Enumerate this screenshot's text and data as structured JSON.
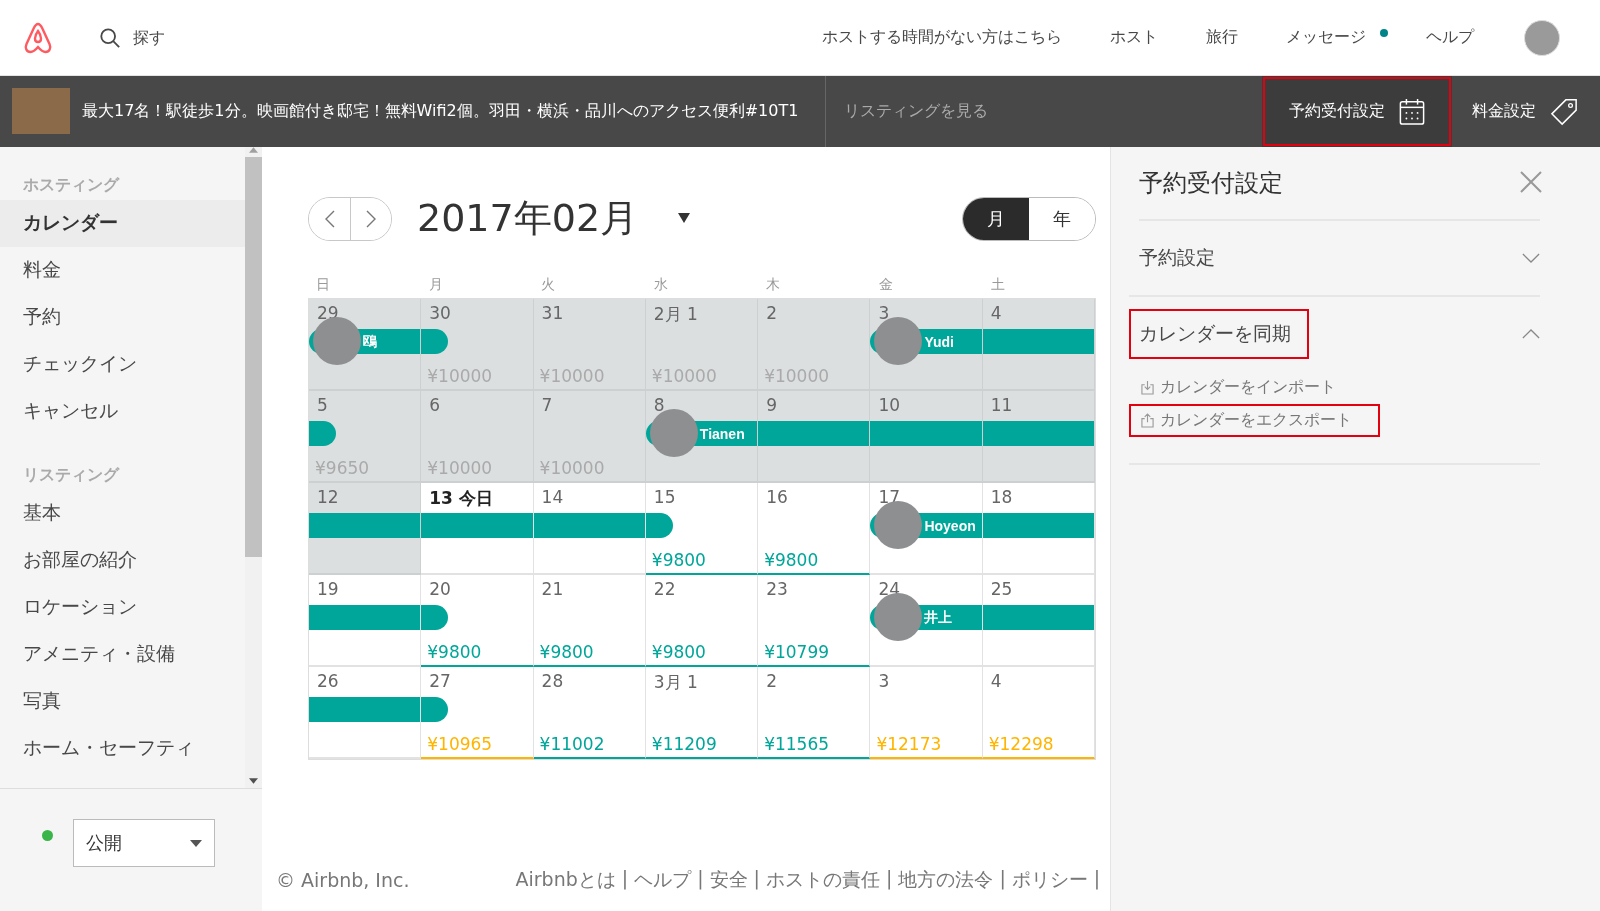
{
  "top_nav": {
    "search": {
      "placeholder": "探す"
    },
    "links": [
      {
        "label": "ホストする時間がない方はこちら",
        "unread": false
      },
      {
        "label": "ホスト",
        "unread": false
      },
      {
        "label": "旅行",
        "unread": false
      },
      {
        "label": "メッセージ",
        "unread": true
      },
      {
        "label": "ヘルプ",
        "unread": false
      }
    ]
  },
  "listing_bar": {
    "title": "最大17名！駅徒歩1分。映画館付き邸宅！無料Wifi2個。羽田・横浜・品川へのアクセス便利#10T1",
    "view_link": "リスティングを見る",
    "buttons": [
      {
        "label": "予約受付設定",
        "kind": "calendar",
        "selected": true,
        "highlighted": true
      },
      {
        "label": "料金設定",
        "kind": "tag",
        "selected": false,
        "highlighted": false
      }
    ]
  },
  "sidebar": {
    "sections": [
      {
        "heading": "ホスティング",
        "items": [
          {
            "label": "カレンダー",
            "selected": true
          },
          {
            "label": "料金",
            "selected": false
          },
          {
            "label": "予約",
            "selected": false
          },
          {
            "label": "チェックイン",
            "selected": false
          },
          {
            "label": "キャンセル",
            "selected": false
          }
        ]
      },
      {
        "heading": "リスティング",
        "items": [
          {
            "label": "基本",
            "selected": false
          },
          {
            "label": "お部屋の紹介",
            "selected": false
          },
          {
            "label": "ロケーション",
            "selected": false
          },
          {
            "label": "アメニティ・設備",
            "selected": false
          },
          {
            "label": "写真",
            "selected": false
          },
          {
            "label": "ホーム・セーフティ",
            "selected": false
          }
        ]
      }
    ],
    "status": {
      "value": "公開"
    }
  },
  "calendar": {
    "month": "2017年02月",
    "views": [
      {
        "label": "月",
        "selected": true
      },
      {
        "label": "年",
        "selected": false
      }
    ],
    "weekdays": [
      "日",
      "月",
      "火",
      "水",
      "木",
      "金",
      "土"
    ],
    "weeks": [
      [
        {
          "date": "29",
          "past": true,
          "today": false,
          "booked": true,
          "checkout": false,
          "guest": "鴎"
        },
        {
          "date": "30",
          "price": "¥10000",
          "high_demand": false,
          "past": true,
          "today": false,
          "booked": false,
          "checkout": true
        },
        {
          "date": "31",
          "price": "¥10000",
          "high_demand": false,
          "past": true,
          "today": false,
          "booked": false,
          "checkout": false
        },
        {
          "date": "2月 1",
          "price": "¥10000",
          "high_demand": false,
          "past": true,
          "today": false,
          "booked": false,
          "checkout": false
        },
        {
          "date": "2",
          "price": "¥10000",
          "high_demand": false,
          "past": true,
          "today": false,
          "booked": false,
          "checkout": false
        },
        {
          "date": "3",
          "past": true,
          "today": false,
          "booked": true,
          "checkout": false,
          "guest": "Yudi"
        },
        {
          "date": "4",
          "past": true,
          "today": false,
          "booked": true,
          "checkout": false
        }
      ],
      [
        {
          "date": "5",
          "price": "¥9650",
          "high_demand": false,
          "past": true,
          "today": false,
          "booked": false,
          "checkout": true
        },
        {
          "date": "6",
          "price": "¥10000",
          "high_demand": false,
          "past": true,
          "today": false,
          "booked": false,
          "checkout": false
        },
        {
          "date": "7",
          "price": "¥10000",
          "high_demand": false,
          "past": true,
          "today": false,
          "booked": false,
          "checkout": false
        },
        {
          "date": "8",
          "past": true,
          "today": false,
          "booked": true,
          "checkout": false,
          "guest": "Tianen"
        },
        {
          "date": "9",
          "past": true,
          "today": false,
          "booked": true,
          "checkout": false
        },
        {
          "date": "10",
          "past": true,
          "today": false,
          "booked": true,
          "checkout": false
        },
        {
          "date": "11",
          "past": true,
          "today": false,
          "booked": true,
          "checkout": false
        }
      ],
      [
        {
          "date": "12",
          "past": true,
          "today": false,
          "booked": true,
          "checkout": false
        },
        {
          "date": "13 今日",
          "past": false,
          "today": true,
          "booked": true,
          "checkout": false
        },
        {
          "date": "14",
          "past": false,
          "today": false,
          "booked": true,
          "checkout": false
        },
        {
          "date": "15",
          "price": "¥9800",
          "high_demand": false,
          "past": false,
          "today": false,
          "booked": false,
          "checkout": true
        },
        {
          "date": "16",
          "price": "¥9800",
          "high_demand": false,
          "past": false,
          "today": false,
          "booked": false,
          "checkout": false
        },
        {
          "date": "17",
          "past": false,
          "today": false,
          "booked": true,
          "checkout": false,
          "guest": "Hoyeon"
        },
        {
          "date": "18",
          "past": false,
          "today": false,
          "booked": true,
          "checkout": false
        }
      ],
      [
        {
          "date": "19",
          "past": false,
          "today": false,
          "booked": true,
          "checkout": false
        },
        {
          "date": "20",
          "price": "¥9800",
          "high_demand": false,
          "past": false,
          "today": false,
          "booked": false,
          "checkout": true
        },
        {
          "date": "21",
          "price": "¥9800",
          "high_demand": false,
          "past": false,
          "today": false,
          "booked": false,
          "checkout": false
        },
        {
          "date": "22",
          "price": "¥9800",
          "high_demand": false,
          "past": false,
          "today": false,
          "booked": false,
          "checkout": false
        },
        {
          "date": "23",
          "price": "¥10799",
          "high_demand": false,
          "past": false,
          "today": false,
          "booked": false,
          "checkout": false
        },
        {
          "date": "24",
          "past": false,
          "today": false,
          "booked": true,
          "checkout": false,
          "guest": "井上"
        },
        {
          "date": "25",
          "past": false,
          "today": false,
          "booked": true,
          "checkout": false
        }
      ],
      [
        {
          "date": "26",
          "past": false,
          "today": false,
          "booked": true,
          "checkout": false
        },
        {
          "date": "27",
          "price": "¥10965",
          "high_demand": true,
          "past": false,
          "today": false,
          "booked": false,
          "checkout": true
        },
        {
          "date": "28",
          "price": "¥11002",
          "high_demand": false,
          "past": false,
          "today": false,
          "booked": false,
          "checkout": false
        },
        {
          "date": "3月 1",
          "price": "¥11209",
          "high_demand": false,
          "past": false,
          "today": false,
          "booked": false,
          "checkout": false
        },
        {
          "date": "2",
          "price": "¥11565",
          "high_demand": false,
          "past": false,
          "today": false,
          "booked": false,
          "checkout": false
        },
        {
          "date": "3",
          "price": "¥12173",
          "high_demand": true,
          "past": false,
          "today": false,
          "booked": false,
          "checkout": false
        },
        {
          "date": "4",
          "price": "¥12298",
          "high_demand": true,
          "past": false,
          "today": false,
          "booked": false,
          "checkout": false
        }
      ]
    ]
  },
  "panel": {
    "title": "予約受付設定",
    "sections": [
      {
        "label": "予約設定",
        "expanded": false,
        "highlighted": false
      },
      {
        "label": "カレンダーを同期",
        "expanded": true,
        "highlighted": true,
        "items": [
          {
            "label": "カレンダーをインポート",
            "kind": "import",
            "highlighted": false
          },
          {
            "label": "カレンダーをエクスポート",
            "kind": "export",
            "highlighted": true
          }
        ]
      }
    ]
  },
  "footer": {
    "copyright": "© Airbnb, Inc.",
    "separator": "|",
    "links": [
      "Airbnbとは",
      "ヘルプ",
      "安全",
      "ホストの責任",
      "地方の法令",
      "ポリシー"
    ]
  }
}
